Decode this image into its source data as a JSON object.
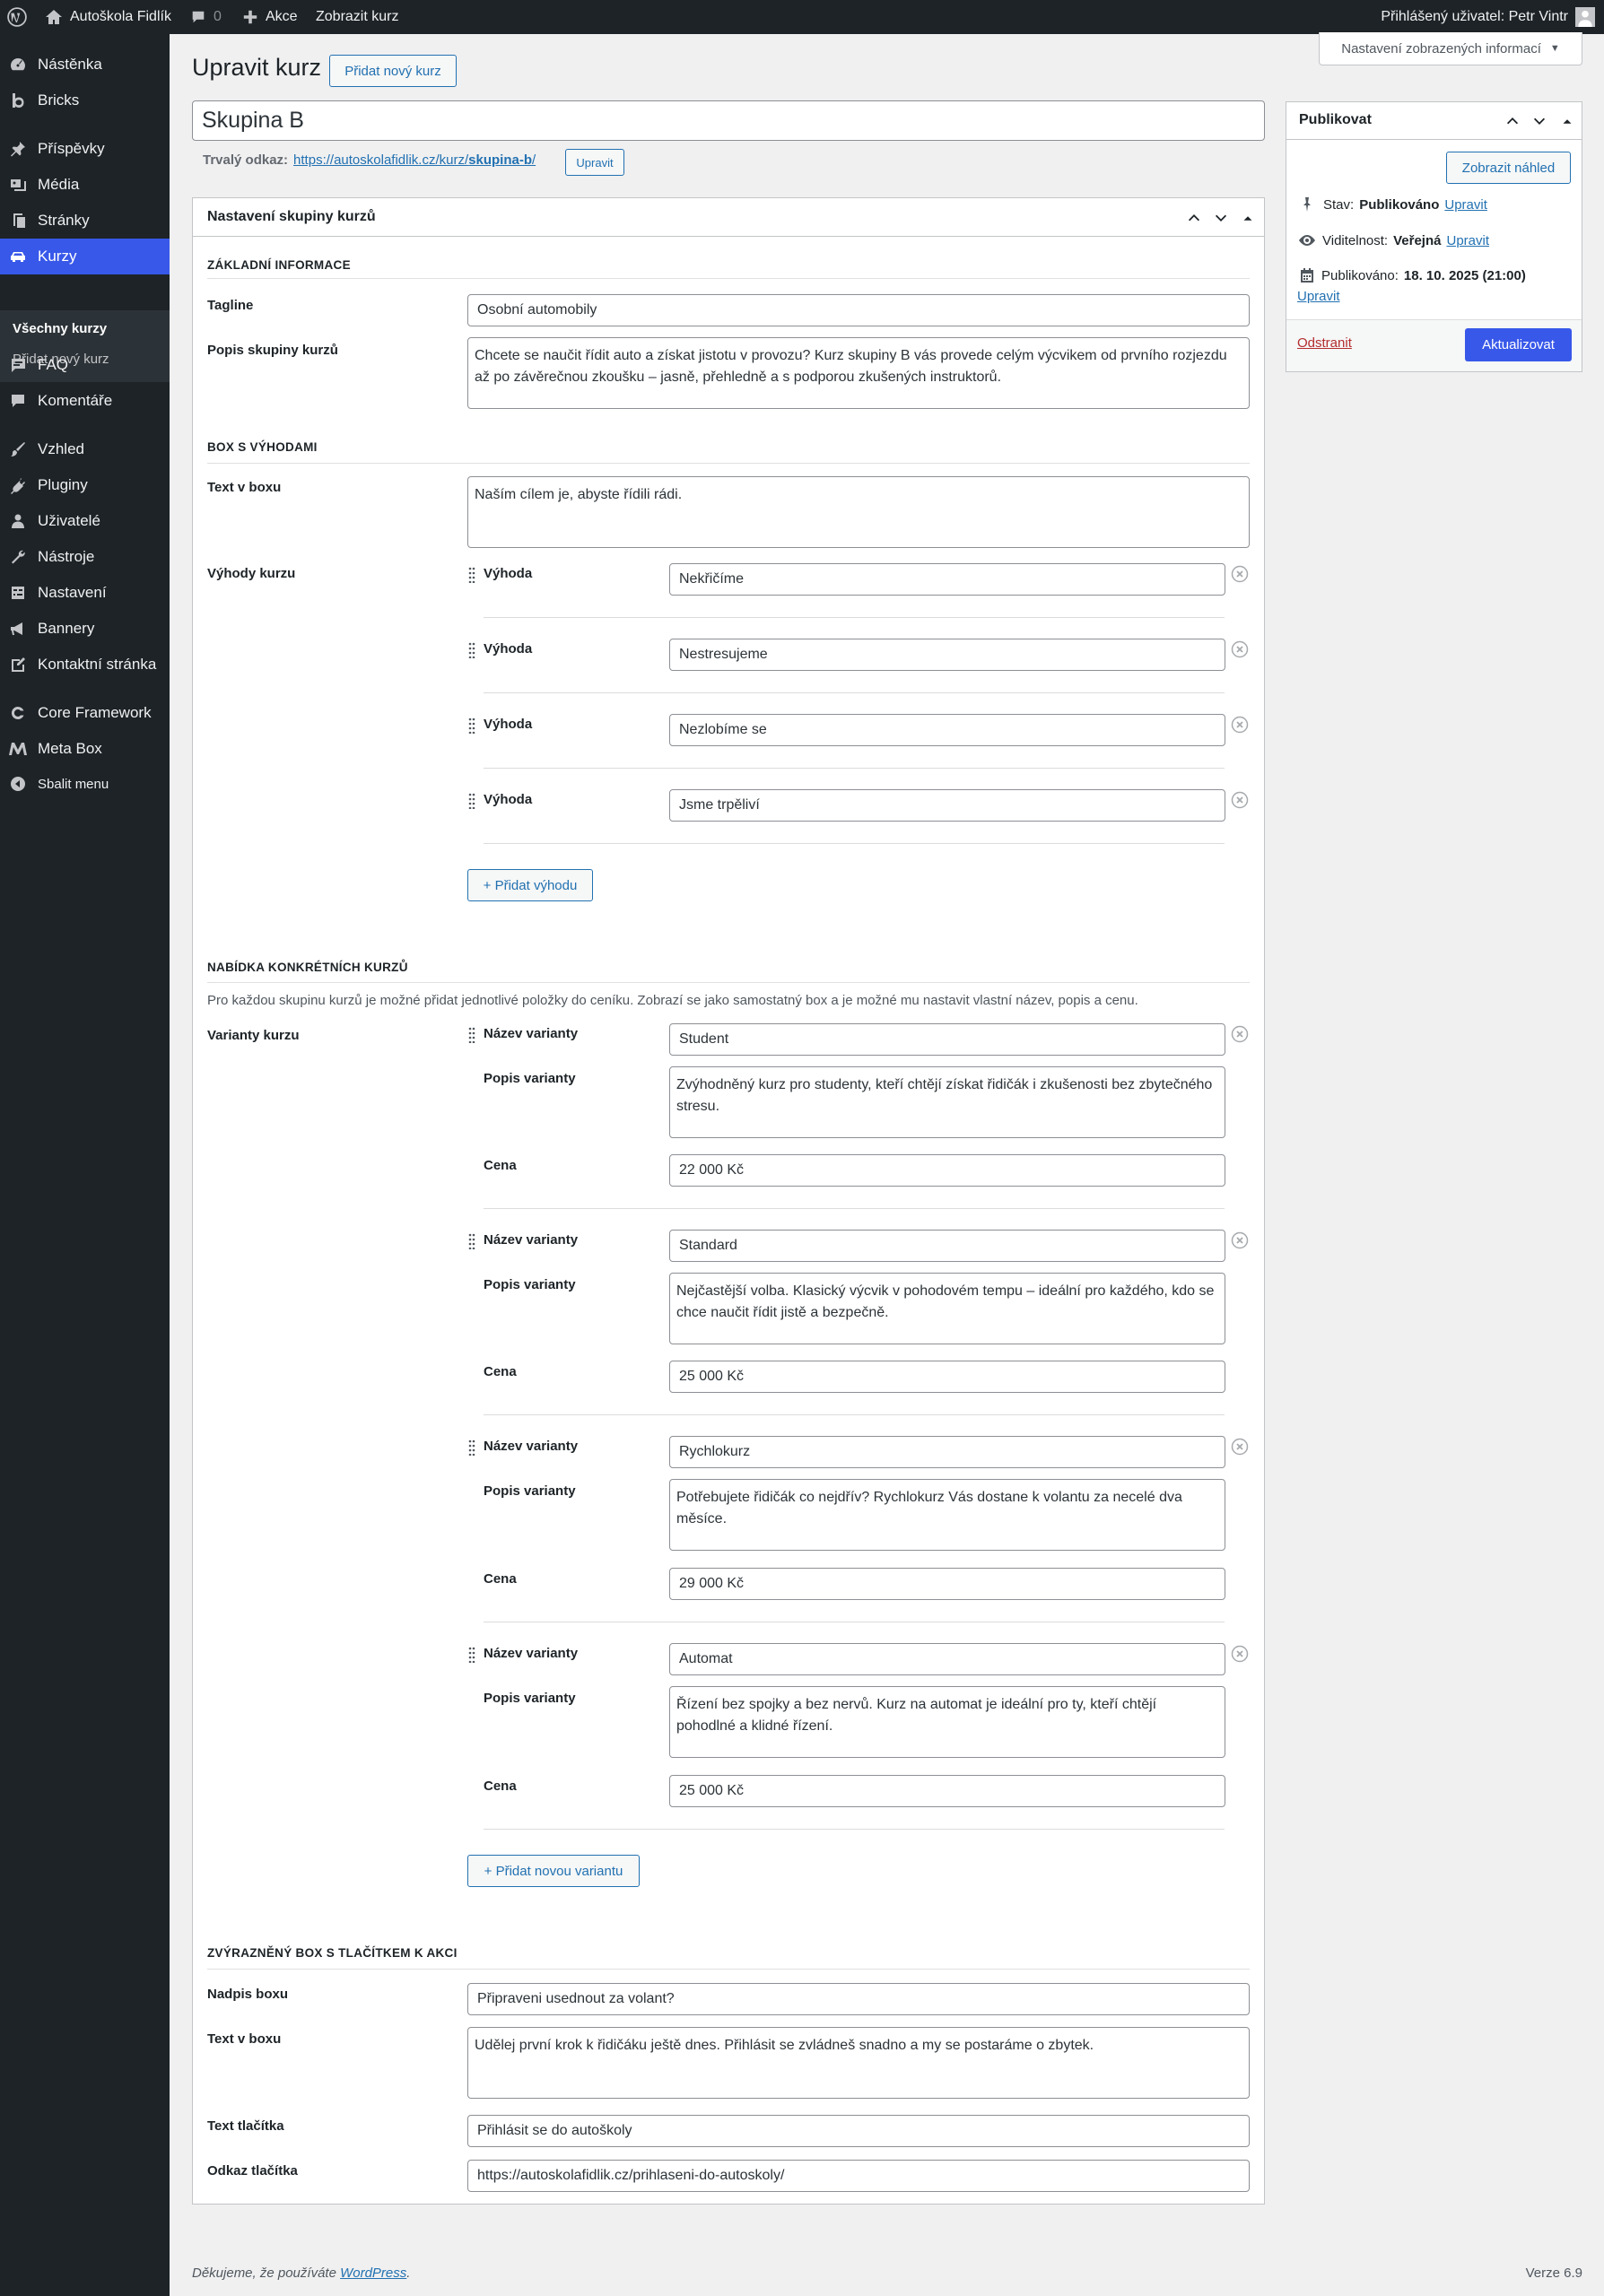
{
  "admin_bar": {
    "site_name": "Autoškola Fidlík",
    "comments_count": "0",
    "new_label": "Akce",
    "view_label": "Zobrazit kurz",
    "user_greeting": "Přihlášený uživatel: Petr Vintr"
  },
  "sidebar": {
    "items": [
      {
        "label": "Nástěnka",
        "icon": "dashboard-icon"
      },
      {
        "label": "Bricks",
        "icon": "bricks-icon"
      },
      {
        "label": "Příspěvky",
        "icon": "pin-icon"
      },
      {
        "label": "Média",
        "icon": "media-icon"
      },
      {
        "label": "Stránky",
        "icon": "pages-icon"
      },
      {
        "label": "Kurzy",
        "icon": "car-icon"
      },
      {
        "label": "FAQ",
        "icon": "faq-icon"
      },
      {
        "label": "Komentáře",
        "icon": "comment-icon"
      },
      {
        "label": "Vzhled",
        "icon": "brush-icon"
      },
      {
        "label": "Pluginy",
        "icon": "plugin-icon"
      },
      {
        "label": "Uživatelé",
        "icon": "user-icon"
      },
      {
        "label": "Nástroje",
        "icon": "wrench-icon"
      },
      {
        "label": "Nastavení",
        "icon": "settings-icon"
      },
      {
        "label": "Bannery",
        "icon": "megaphone-icon"
      },
      {
        "label": "Kontaktní stránka",
        "icon": "edit-page-icon"
      },
      {
        "label": "Core Framework",
        "icon": "core-framework-icon"
      },
      {
        "label": "Meta Box",
        "icon": "meta-box-icon"
      },
      {
        "label": "Sbalit menu",
        "icon": "collapse-icon"
      }
    ],
    "submenu": {
      "all": "Všechny kurzy",
      "add": "Přidat nový kurz"
    }
  },
  "header": {
    "title": "Upravit kurz",
    "add_new": "Přidat nový kurz",
    "screen_options": "Nastavení zobrazených informací"
  },
  "post": {
    "title": "Skupina B",
    "permalink_label": "Trvalý odkaz:",
    "permalink_base": "https://autoskolafidlik.cz/kurz/",
    "permalink_slug": "skupina-b",
    "permalink_end": "/",
    "permalink_edit": "Upravit"
  },
  "metabox": {
    "title": "Nastavení skupiny kurzů",
    "basic": {
      "heading": "ZÁKLADNÍ INFORMACE",
      "tagline_label": "Tagline",
      "tagline": "Osobní automobily",
      "desc_label": "Popis skupiny kurzů",
      "desc": "Chcete se naučit řídit auto a získat jistotu v provozu? Kurz skupiny B vás provede celým výcvikem od prvního rozjezdu až po závěrečnou zkoušku – jasně, přehledně a s podporou zkušených instruktorů."
    },
    "benefits": {
      "heading": "BOX S VÝHODAMI",
      "text_label": "Text v boxu",
      "text": "Naším cílem je, abyste řídili rádi.",
      "list_label": "Výhody kurzu",
      "item_label": "Výhoda",
      "items": [
        "Nekřičíme",
        "Nestresujeme",
        "Nezlobíme se",
        "Jsme trpěliví"
      ],
      "add_label": "+ Přidat výhodu"
    },
    "offer": {
      "heading": "NABÍDKA KONKRÉTNÍCH KURZŮ",
      "note": "Pro každou skupinu kurzů je možné přidat jednotlivé položky do ceníku. Zobrazí se jako samostatný box a je možné mu nastavit vlastní název, popis a cenu.",
      "list_label": "Varianty kurzu",
      "name_label": "Název varianty",
      "desc_label": "Popis varianty",
      "price_label": "Cena",
      "variants": [
        {
          "name": "Student",
          "desc": "Zvýhodněný kurz pro studenty, kteří chtějí získat řidičák i zkušenosti bez zbytečného stresu.",
          "price": "22 000 Kč"
        },
        {
          "name": "Standard",
          "desc": "Nejčastější volba. Klasický výcvik v pohodovém tempu – ideální pro každého, kdo se chce naučit řídit jistě a bezpečně.",
          "price": "25 000 Kč"
        },
        {
          "name": "Rychlokurz",
          "desc": "Potřebujete řidičák co nejdřív? Rychlokurz Vás dostane k volantu za necelé dva měsíce.",
          "price": "29 000 Kč"
        },
        {
          "name": "Automat",
          "desc": "Řízení bez spojky a bez nervů. Kurz na automat je ideální pro ty, kteří chtějí pohodlné a klidné řízení.",
          "price": "25 000 Kč"
        }
      ],
      "add_label": "+ Přidat novou variantu"
    },
    "cta": {
      "heading": "ZVÝRAZNĚNÝ BOX S TLAČÍTKEM K AKCI",
      "title_label": "Nadpis boxu",
      "title": "Připraveni usednout za volant?",
      "text_label": "Text v boxu",
      "text": "Udělej první krok k řidičáku ještě dnes. Přihlásit se zvládneš snadno a my se postaráme o zbytek.",
      "btn_text_label": "Text tlačítka",
      "btn_text": "Přihlásit se do autoškoly",
      "btn_link_label": "Odkaz tlačítka",
      "btn_link": "https://autoskolafidlik.cz/prihlaseni-do-autoskoly/"
    }
  },
  "publish": {
    "title": "Publikovat",
    "preview": "Zobrazit náhled",
    "status_label": "Stav:",
    "status_value": "Publikováno",
    "visibility_label": "Viditelnost:",
    "visibility_value": "Veřejná",
    "published_label": "Publikováno:",
    "published_value": "18. 10. 2025 (21:00)",
    "edit": "Upravit",
    "trash": "Odstranit",
    "update": "Aktualizovat"
  },
  "footer": {
    "thanks_prefix": "Děkujeme, že používáte",
    "thanks_link": "WordPress",
    "thanks_suffix": ".",
    "version": "Verze 6.9"
  }
}
